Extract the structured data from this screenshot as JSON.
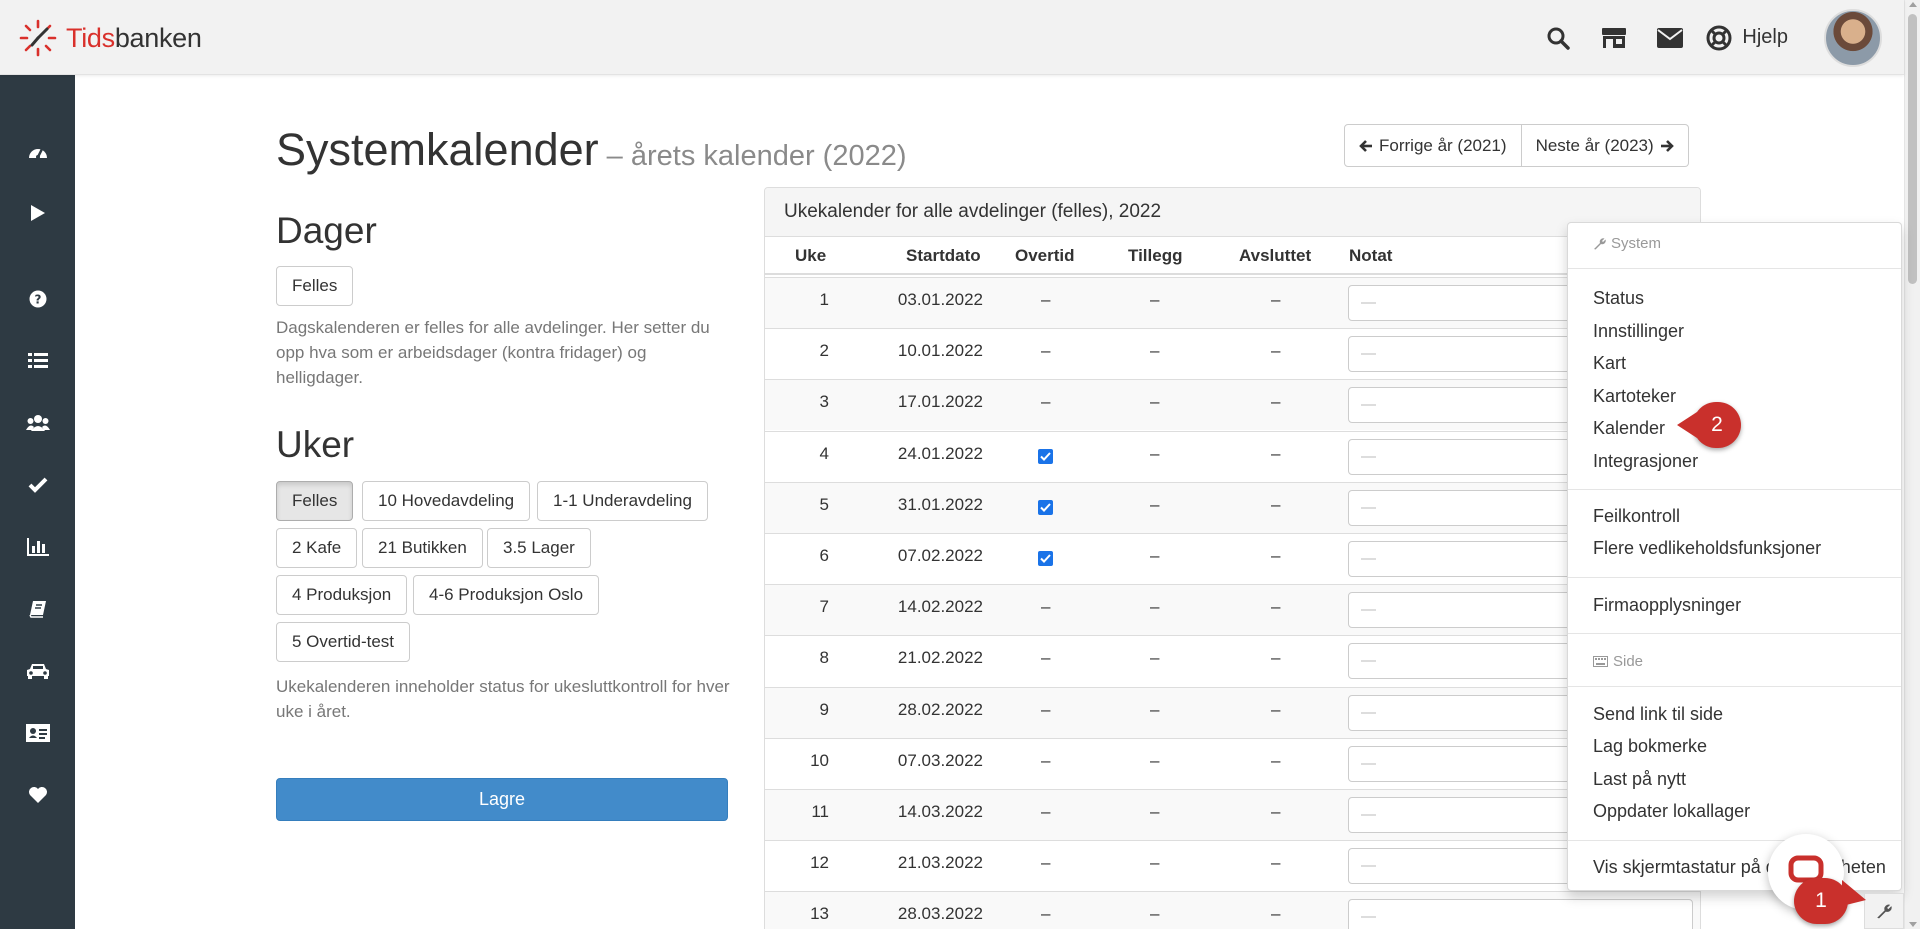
{
  "app": {
    "logo_text_prefix": "Tids",
    "logo_text_suffix": "banken",
    "help_label": "Hjelp"
  },
  "colors": {
    "brand_red": "#d9302b",
    "sidebar_bg": "#2e3a43",
    "primary_blue": "#428bca",
    "callout_red": "#c9302c",
    "checkbox_blue": "#1a73e8"
  },
  "topbar": {
    "icons": [
      "search-icon",
      "store-icon",
      "envelope-icon",
      "lifebuoy-icon"
    ]
  },
  "sidebar": {
    "icons": [
      "dashboard-icon",
      "play-icon",
      "question-icon",
      "list-icon",
      "users-icon",
      "check-icon",
      "bar-chart-icon",
      "book-icon",
      "car-icon",
      "id-card-icon",
      "heart-icon"
    ]
  },
  "page": {
    "title": "Systemkalender",
    "subtitle": "– årets kalender (2022)",
    "prev_year": "Forrige år (2021)",
    "next_year": "Neste år (2023)"
  },
  "days": {
    "heading": "Dager",
    "button": "Felles",
    "help": "Dagskalenderen er felles for alle avdelinger. Her setter du opp hva som er arbeidsdager (kontra fridager) og helligdager."
  },
  "weeks": {
    "heading": "Uker",
    "departments": [
      "Felles",
      "10 Hovedavdeling",
      "1-1 Underavdeling",
      "2 Kafe",
      "21 Butikken",
      "3.5 Lager",
      "4 Produksjon",
      "4-6 Produksjon Oslo",
      "5 Overtid-test"
    ],
    "active_index": 0,
    "help": "Ukekalenderen inneholder status for ukesluttkontroll for hver uke i året.",
    "save": "Lagre"
  },
  "table": {
    "heading": "Ukekalender for alle avdelinger (felles), 2022",
    "columns": [
      "Uke",
      "Startdato",
      "Overtid",
      "Tillegg",
      "Avsluttet",
      "Notat"
    ],
    "note_placeholder": "—",
    "rows": [
      {
        "uke": "1",
        "start": "03.01.2022",
        "overtid": "–",
        "tillegg": "–",
        "avsluttet": "–",
        "checked": false
      },
      {
        "uke": "2",
        "start": "10.01.2022",
        "overtid": "–",
        "tillegg": "–",
        "avsluttet": "–",
        "checked": false
      },
      {
        "uke": "3",
        "start": "17.01.2022",
        "overtid": "–",
        "tillegg": "–",
        "avsluttet": "–",
        "checked": false
      },
      {
        "uke": "4",
        "start": "24.01.2022",
        "overtid": "",
        "tillegg": "–",
        "avsluttet": "–",
        "checked": true
      },
      {
        "uke": "5",
        "start": "31.01.2022",
        "overtid": "",
        "tillegg": "–",
        "avsluttet": "–",
        "checked": true
      },
      {
        "uke": "6",
        "start": "07.02.2022",
        "overtid": "",
        "tillegg": "–",
        "avsluttet": "–",
        "checked": true
      },
      {
        "uke": "7",
        "start": "14.02.2022",
        "overtid": "–",
        "tillegg": "–",
        "avsluttet": "–",
        "checked": false
      },
      {
        "uke": "8",
        "start": "21.02.2022",
        "overtid": "–",
        "tillegg": "–",
        "avsluttet": "–",
        "checked": false
      },
      {
        "uke": "9",
        "start": "28.02.2022",
        "overtid": "–",
        "tillegg": "–",
        "avsluttet": "–",
        "checked": false
      },
      {
        "uke": "10",
        "start": "07.03.2022",
        "overtid": "–",
        "tillegg": "–",
        "avsluttet": "–",
        "checked": false
      },
      {
        "uke": "11",
        "start": "14.03.2022",
        "overtid": "–",
        "tillegg": "–",
        "avsluttet": "–",
        "checked": false
      },
      {
        "uke": "12",
        "start": "21.03.2022",
        "overtid": "–",
        "tillegg": "–",
        "avsluttet": "–",
        "checked": false
      },
      {
        "uke": "13",
        "start": "28.03.2022",
        "overtid": "–",
        "tillegg": "–",
        "avsluttet": "–",
        "checked": false
      }
    ]
  },
  "menu": {
    "system_header": "System",
    "group1": [
      "Status",
      "Innstillinger",
      "Kart",
      "Kartoteker",
      "Kalender",
      "Integrasjoner"
    ],
    "group2": [
      "Feilkontroll",
      "Flere vedlikeholdsfunksjoner"
    ],
    "group3": [
      "Firmaopplysninger"
    ],
    "side_header": "Side",
    "group4": [
      "Send link til side",
      "Lag bokmerke",
      "Last på nytt",
      "Oppdater lokallager"
    ],
    "group5": [
      "Vis skjermtastatur på denne enheten"
    ]
  },
  "callouts": {
    "one": "1",
    "two": "2"
  }
}
